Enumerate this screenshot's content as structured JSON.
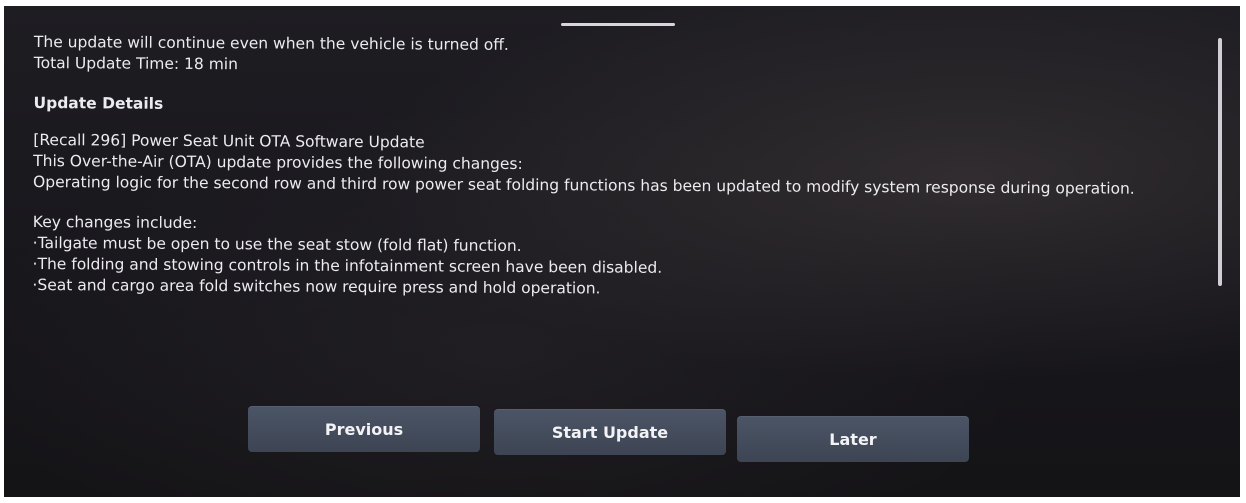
{
  "summary": {
    "line1": "The update will continue even when the vehicle is turned off.",
    "line2": "Total Update Time: 18 min"
  },
  "details": {
    "title": "Update Details",
    "name": "[Recall 296] Power Seat Unit OTA Software Update",
    "intro": "This Over-the-Air (OTA) update provides the following changes:",
    "description": "Operating logic for the second row and third row power seat folding functions has been updated to modify system response during operation."
  },
  "key_changes": {
    "title": "Key changes include:",
    "items": [
      "·Tailgate must be open to use the seat stow (fold flat) function.",
      "·The folding and stowing controls in the infotainment screen have been disabled.",
      "·Seat and cargo area fold switches now require press and hold operation."
    ]
  },
  "buttons": {
    "previous": "Previous",
    "start_update": "Start Update",
    "later": "Later"
  }
}
